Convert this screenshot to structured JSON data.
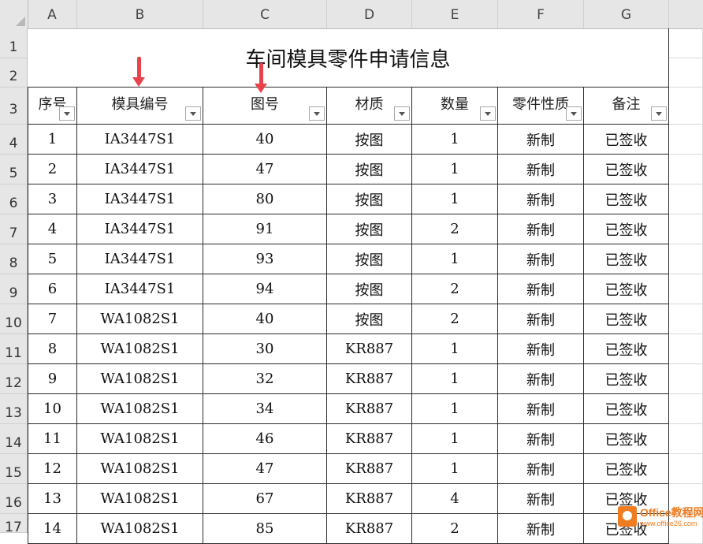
{
  "columns": [
    "A",
    "B",
    "C",
    "D",
    "E",
    "F",
    "G"
  ],
  "row_numbers": [
    "1",
    "2",
    "3",
    "4",
    "5",
    "6",
    "7",
    "8",
    "9",
    "10",
    "11",
    "12",
    "13",
    "14",
    "15",
    "16",
    "17"
  ],
  "title": "车间模具零件申请信息",
  "table": {
    "headers": [
      "序号",
      "模具编号",
      "图号",
      "材质",
      "数量",
      "零件性质",
      "备注"
    ],
    "rows": [
      [
        "1",
        "IA3447S1",
        "40",
        "按图",
        "1",
        "新制",
        "已签收"
      ],
      [
        "2",
        "IA3447S1",
        "47",
        "按图",
        "1",
        "新制",
        "已签收"
      ],
      [
        "3",
        "IA3447S1",
        "80",
        "按图",
        "1",
        "新制",
        "已签收"
      ],
      [
        "4",
        "IA3447S1",
        "91",
        "按图",
        "2",
        "新制",
        "已签收"
      ],
      [
        "5",
        "IA3447S1",
        "93",
        "按图",
        "1",
        "新制",
        "已签收"
      ],
      [
        "6",
        "IA3447S1",
        "94",
        "按图",
        "2",
        "新制",
        "已签收"
      ],
      [
        "7",
        "WA1082S1",
        "40",
        "按图",
        "2",
        "新制",
        "已签收"
      ],
      [
        "8",
        "WA1082S1",
        "30",
        "KR887",
        "1",
        "新制",
        "已签收"
      ],
      [
        "9",
        "WA1082S1",
        "32",
        "KR887",
        "1",
        "新制",
        "已签收"
      ],
      [
        "10",
        "WA1082S1",
        "34",
        "KR887",
        "1",
        "新制",
        "已签收"
      ],
      [
        "11",
        "WA1082S1",
        "46",
        "KR887",
        "1",
        "新制",
        "已签收"
      ],
      [
        "12",
        "WA1082S1",
        "47",
        "KR887",
        "1",
        "新制",
        "已签收"
      ],
      [
        "13",
        "WA1082S1",
        "67",
        "KR887",
        "4",
        "新制",
        "已签收"
      ],
      [
        "14",
        "WA1082S1",
        "85",
        "KR887",
        "2",
        "新制",
        "已签收"
      ]
    ]
  },
  "watermark": {
    "brand": "Office教程网",
    "url": "www.office26.com"
  },
  "colors": {
    "arrow": "#e8434a",
    "grid": "#2b2b2b",
    "header_bg": "#e6e6e6",
    "watermark": "#f07c21"
  }
}
